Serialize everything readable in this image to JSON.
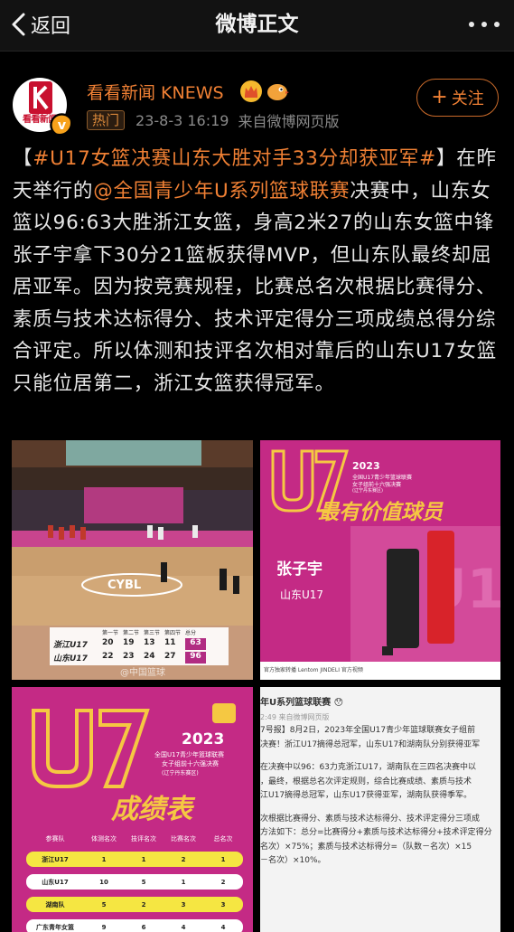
{
  "nav": {
    "back_label": "返回",
    "title": "微博正文"
  },
  "author": {
    "name": "看看新闻 KNEWS",
    "avatar_text": "看看新闻",
    "tag": "热门",
    "time": "23-8-3 16:19",
    "source": "来自微博网页版",
    "follow_label": "关注"
  },
  "post": {
    "topic": "#U17女篮决赛山东大胜对手33分却获亚军#",
    "open_bracket": "【",
    "close_bracket": "】",
    "seg1": "在昨天举行的",
    "mention": "@全国青少年U系列篮球联赛",
    "seg2": "决赛中，山东女篮以96:63大胜浙江女篮，身高2米27的山东女篮中锋张子宇拿下30分21篮板获得MVP，但山东队最终却屈居亚军。因为按竞赛规程，比赛总名次根据比赛得分、素质与技术达标得分、技术评定得分三项成绩总得分综合评定。所以体测和技评名次相对靠后的山东U17女篮只能位居第二，浙江女篮获得冠军。"
  },
  "image1": {
    "scoreboard_head": [
      "第一节",
      "第二节",
      "第三节",
      "第四节",
      "总分"
    ],
    "team1": "浙江U17",
    "team1_scores": [
      "20",
      "19",
      "13",
      "11",
      "63"
    ],
    "team2": "山东U17",
    "team2_scores": [
      "22",
      "23",
      "24",
      "27",
      "96"
    ],
    "watermark": "@中国篮球",
    "banner": "CYBL"
  },
  "image2": {
    "title": "最有价值球员",
    "year": "2023",
    "subtitle1": "全国U17青少年篮球联赛",
    "subtitle2": "女子组前十六强决赛",
    "subtitle3": "(辽宁丹东赛区)",
    "player": "张子宇",
    "team": "山东U17",
    "footer": "官方独家转播  Lentom  JINDELI  官方视频"
  },
  "image3": {
    "big": "U17",
    "year": "2023",
    "subtitle1": "全国U17青少年篮球联赛",
    "subtitle2": "女子组前十六强决赛",
    "subtitle3": "(辽宁丹东赛区)",
    "title": "成绩表",
    "headers": [
      "参赛队",
      "体测名次",
      "技评名次",
      "比赛名次",
      "总名次"
    ],
    "rows": [
      [
        "浙江U17",
        "1",
        "1",
        "2",
        "1"
      ],
      [
        "山东U17",
        "10",
        "5",
        "1",
        "2"
      ],
      [
        "湖南队",
        "5",
        "2",
        "3",
        "3"
      ],
      [
        "广东青年女篮",
        "9",
        "6",
        "4",
        "4"
      ]
    ]
  },
  "image4": {
    "lines": [
      "年U系列篮球联赛 😯",
      "2:49  来自微博网页版",
      "7号报】8月2日，2023年全国U17青少年篮球联赛女子组前",
      "决赛！浙江U17摘得总冠军，山东U17和湖南队分别获得亚军",
      "",
      "在决赛中以96：63力克浙江U17，湖南队在三四名决赛中以",
      "，最终，根据总名次评定规则，综合比赛成绩、素质与技术",
      "江U17摘得总冠军，山东U17获得亚军，湖南队获得季军。",
      "",
      "次根据比赛得分、素质与技术达标得分、技术评定得分三项成",
      "方法如下：总分=比赛得分+素质与技术达标得分+技术评定得分",
      "名次）×75%；素质与技术达标得分=（队数－名次）×15",
      "－名次）×10%。"
    ]
  }
}
